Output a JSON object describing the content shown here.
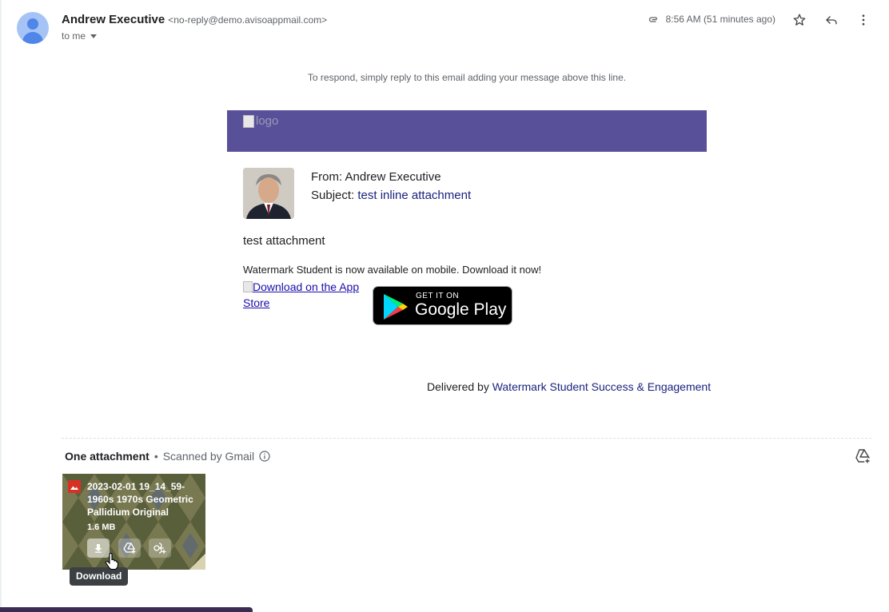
{
  "header": {
    "sender_name": "Andrew Executive",
    "sender_email": "<no-reply@demo.avisoappmail.com>",
    "recipient": "to me",
    "timestamp": "8:56 AM (51 minutes ago)",
    "icons": [
      "attachment-icon",
      "star-icon",
      "reply-icon",
      "more-vert-icon"
    ]
  },
  "email": {
    "reply_notice": "To respond, simply reply to this email adding your message above this line.",
    "logo_alt": "logo",
    "banner_color": "#58519a",
    "from_line": "From: Andrew Executive",
    "subject_label": "Subject: ",
    "subject_value": "test inline attachment",
    "message": "test attachment",
    "promo_text": "Watermark Student is now available on mobile. Download it now!",
    "appstore_alt": "Download on the App Store",
    "gplay_small": "GET IT ON",
    "gplay_big": "Google Play",
    "delivered_prefix": "Delivered by ",
    "delivered_link": "Watermark Student Success & Engagement"
  },
  "attachments": {
    "title": "One attachment",
    "separator": "•",
    "scanned": "Scanned by Gmail",
    "file": {
      "name": "2023-02-01 19_14_59-1960s 1970s Geometric Pallidium Original",
      "size": "1.6 MB",
      "type_icon": "image-icon"
    },
    "tooltip": "Download"
  }
}
